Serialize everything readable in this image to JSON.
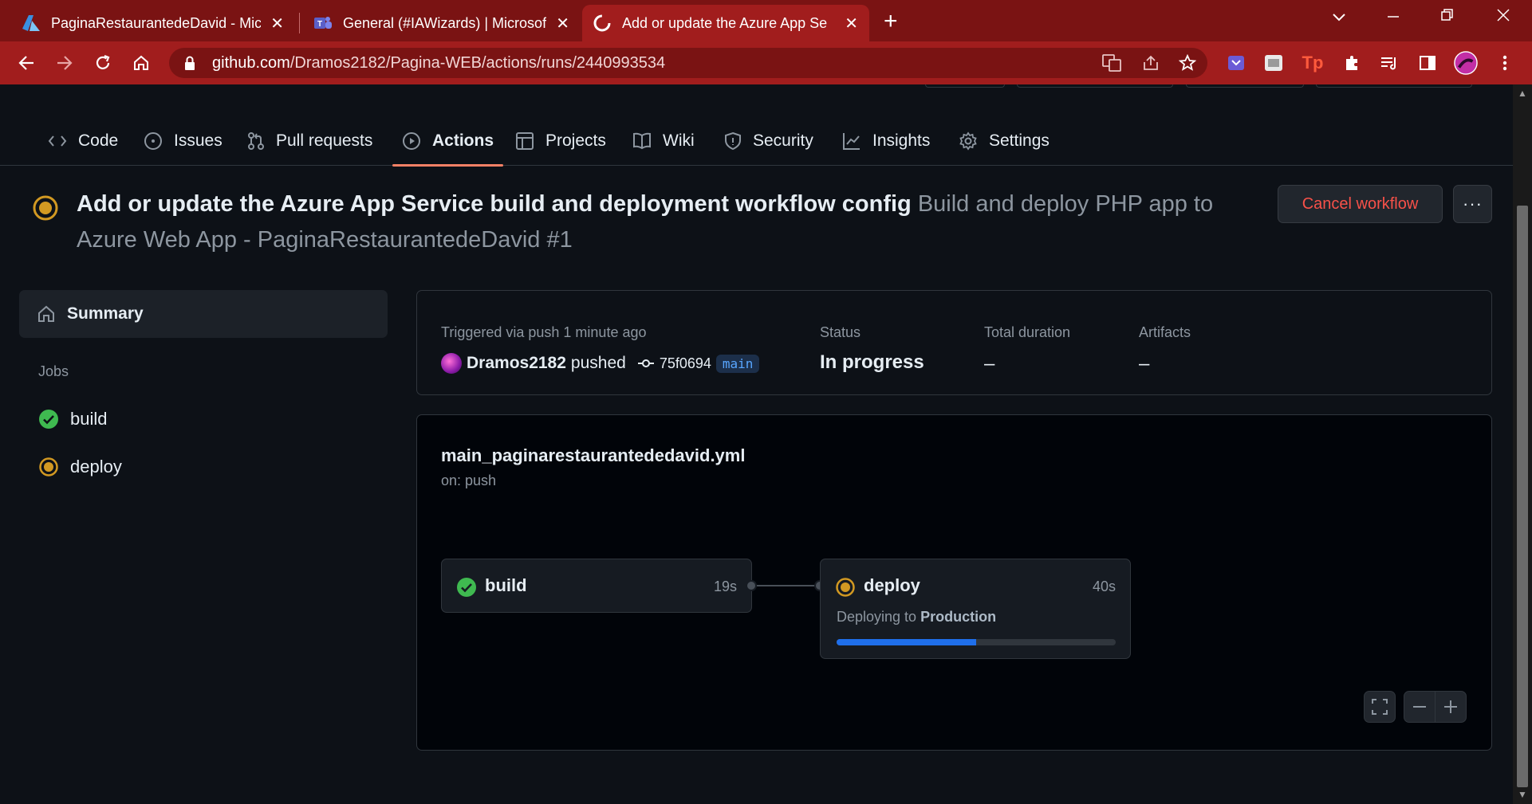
{
  "browser": {
    "tabs": [
      {
        "title": "PaginaRestaurantedeDavid - Micr",
        "icon": "azure-icon"
      },
      {
        "title": "General (#IAWizards) | Microsoft",
        "icon": "teams-icon"
      },
      {
        "title": "Add or update the Azure App Se",
        "icon": "github-icon",
        "active": true
      }
    ],
    "url_host": "github.com",
    "url_path": "/Dramos2182/Pagina-WEB/actions/runs/2440993534",
    "theme_color": "#a11d1d"
  },
  "repo_nav": {
    "items": [
      {
        "label": "Code",
        "icon": "code-icon"
      },
      {
        "label": "Issues",
        "icon": "issue-icon"
      },
      {
        "label": "Pull requests",
        "icon": "pull-request-icon"
      },
      {
        "label": "Actions",
        "icon": "play-icon",
        "active": true
      },
      {
        "label": "Projects",
        "icon": "table-icon"
      },
      {
        "label": "Wiki",
        "icon": "book-icon"
      },
      {
        "label": "Security",
        "icon": "shield-icon"
      },
      {
        "label": "Insights",
        "icon": "graph-icon"
      },
      {
        "label": "Settings",
        "icon": "gear-icon"
      }
    ]
  },
  "run": {
    "title": "Add or update the Azure App Service build and deployment workflow config",
    "subtitle": "Build and deploy PHP app to Azure Web App - PaginaRestaurantedeDavid #1",
    "cancel_label": "Cancel workflow",
    "more_label": "···"
  },
  "sidebar": {
    "summary_label": "Summary",
    "jobs_heading": "Jobs",
    "jobs": [
      {
        "name": "build",
        "status": "success"
      },
      {
        "name": "deploy",
        "status": "in_progress"
      }
    ]
  },
  "info": {
    "trigger_label": "Triggered via push 1 minute ago",
    "actor": "Dramos2182",
    "action": "pushed",
    "commit": "75f0694",
    "branch": "main",
    "status_label": "Status",
    "status_value": "In progress",
    "duration_label": "Total duration",
    "duration_value": "–",
    "artifacts_label": "Artifacts",
    "artifacts_value": "–"
  },
  "graph": {
    "workflow_file": "main_paginarestaurantededavid.yml",
    "trigger": "on: push",
    "jobs": [
      {
        "name": "build",
        "duration": "19s",
        "status": "success"
      },
      {
        "name": "deploy",
        "duration": "40s",
        "status": "in_progress",
        "env_prefix": "Deploying to",
        "env_name": "Production",
        "progress": 0.5
      }
    ]
  },
  "colors": {
    "success": "#3fb950",
    "in_progress": "#d29922",
    "danger": "#f85149",
    "accent": "#1f6feb"
  }
}
